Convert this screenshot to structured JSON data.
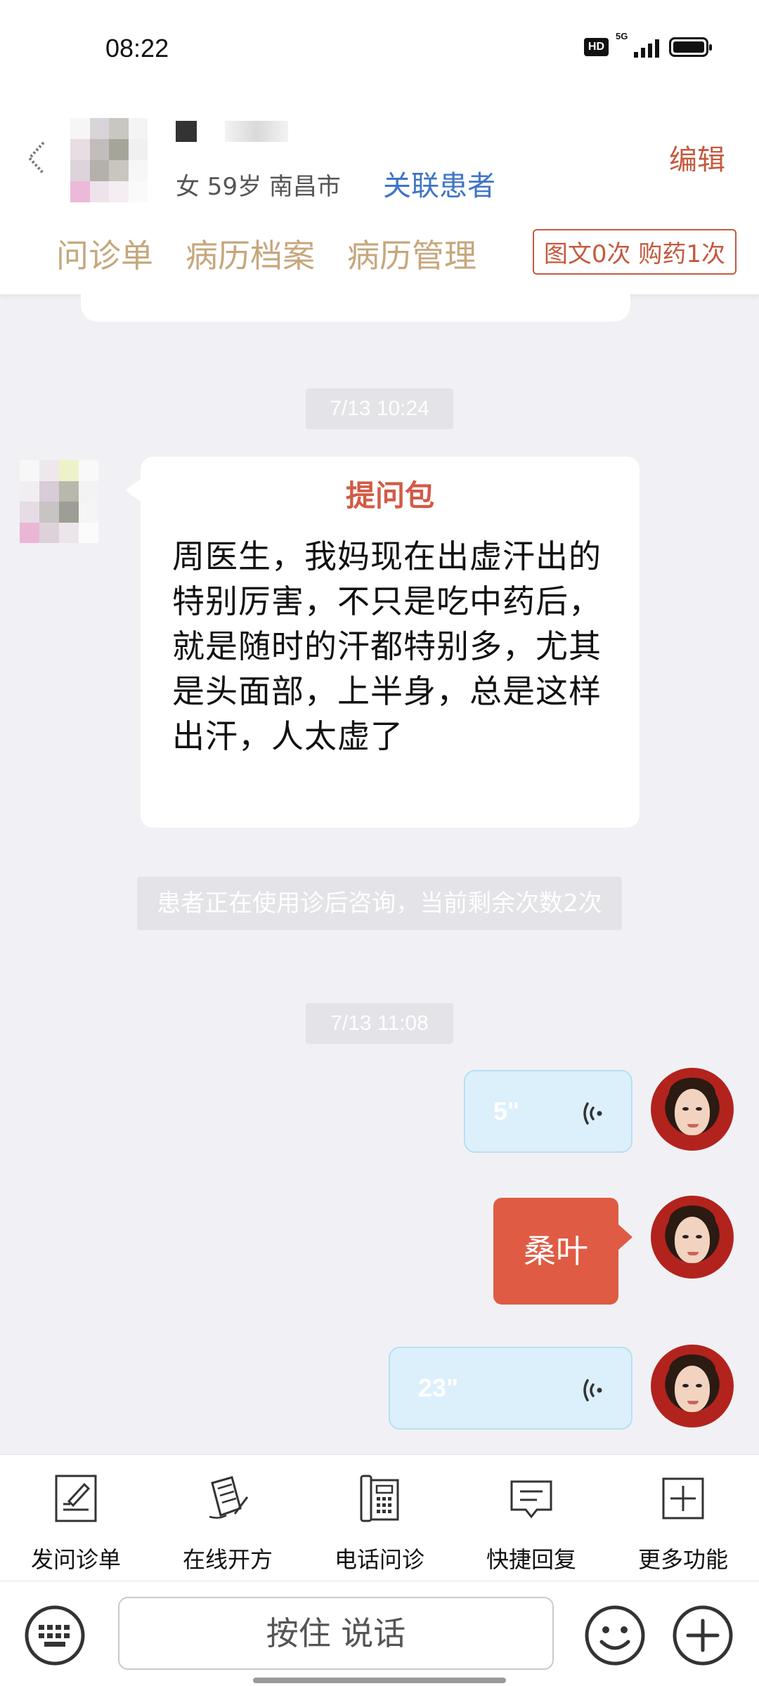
{
  "status_bar": {
    "time": "08:22",
    "hd": "HD",
    "network": "5G"
  },
  "header": {
    "patient_info": "女 59岁  南昌市",
    "link_patient": "关联患者",
    "edit": "编辑",
    "tabs": [
      "问诊单",
      "病历档案",
      "病历管理"
    ],
    "quota": "图文0次 购药1次"
  },
  "chat": {
    "timestamp1": "7/13 10:24",
    "question_title": "提问包",
    "question_text": "周医生，我妈现在出虚汗出的特别厉害，不只是吃中药后，就是随时的汗都特别多，尤其是头面部，上半身，总是这样出汗，人太虚了",
    "notice": "患者正在使用诊后咨询，当前剩余次数2次",
    "timestamp2": "7/13 11:08",
    "voice1_duration": "5\"",
    "herb_message": "桑叶",
    "voice2_duration": "23\""
  },
  "toolbar": {
    "items": [
      {
        "label": "发问诊单",
        "icon": "form-edit-icon"
      },
      {
        "label": "在线开方",
        "icon": "prescription-icon"
      },
      {
        "label": "电话问诊",
        "icon": "phone-icon"
      },
      {
        "label": "快捷回复",
        "icon": "quick-reply-icon"
      },
      {
        "label": "更多功能",
        "icon": "plus-square-icon"
      }
    ]
  },
  "input": {
    "talk_label": "按住 说话"
  },
  "colors": {
    "accent": "#df5b44",
    "tab_gold": "#c6a77d",
    "link_blue": "#3f74c8",
    "voice_bg": "#dcf0fb"
  }
}
